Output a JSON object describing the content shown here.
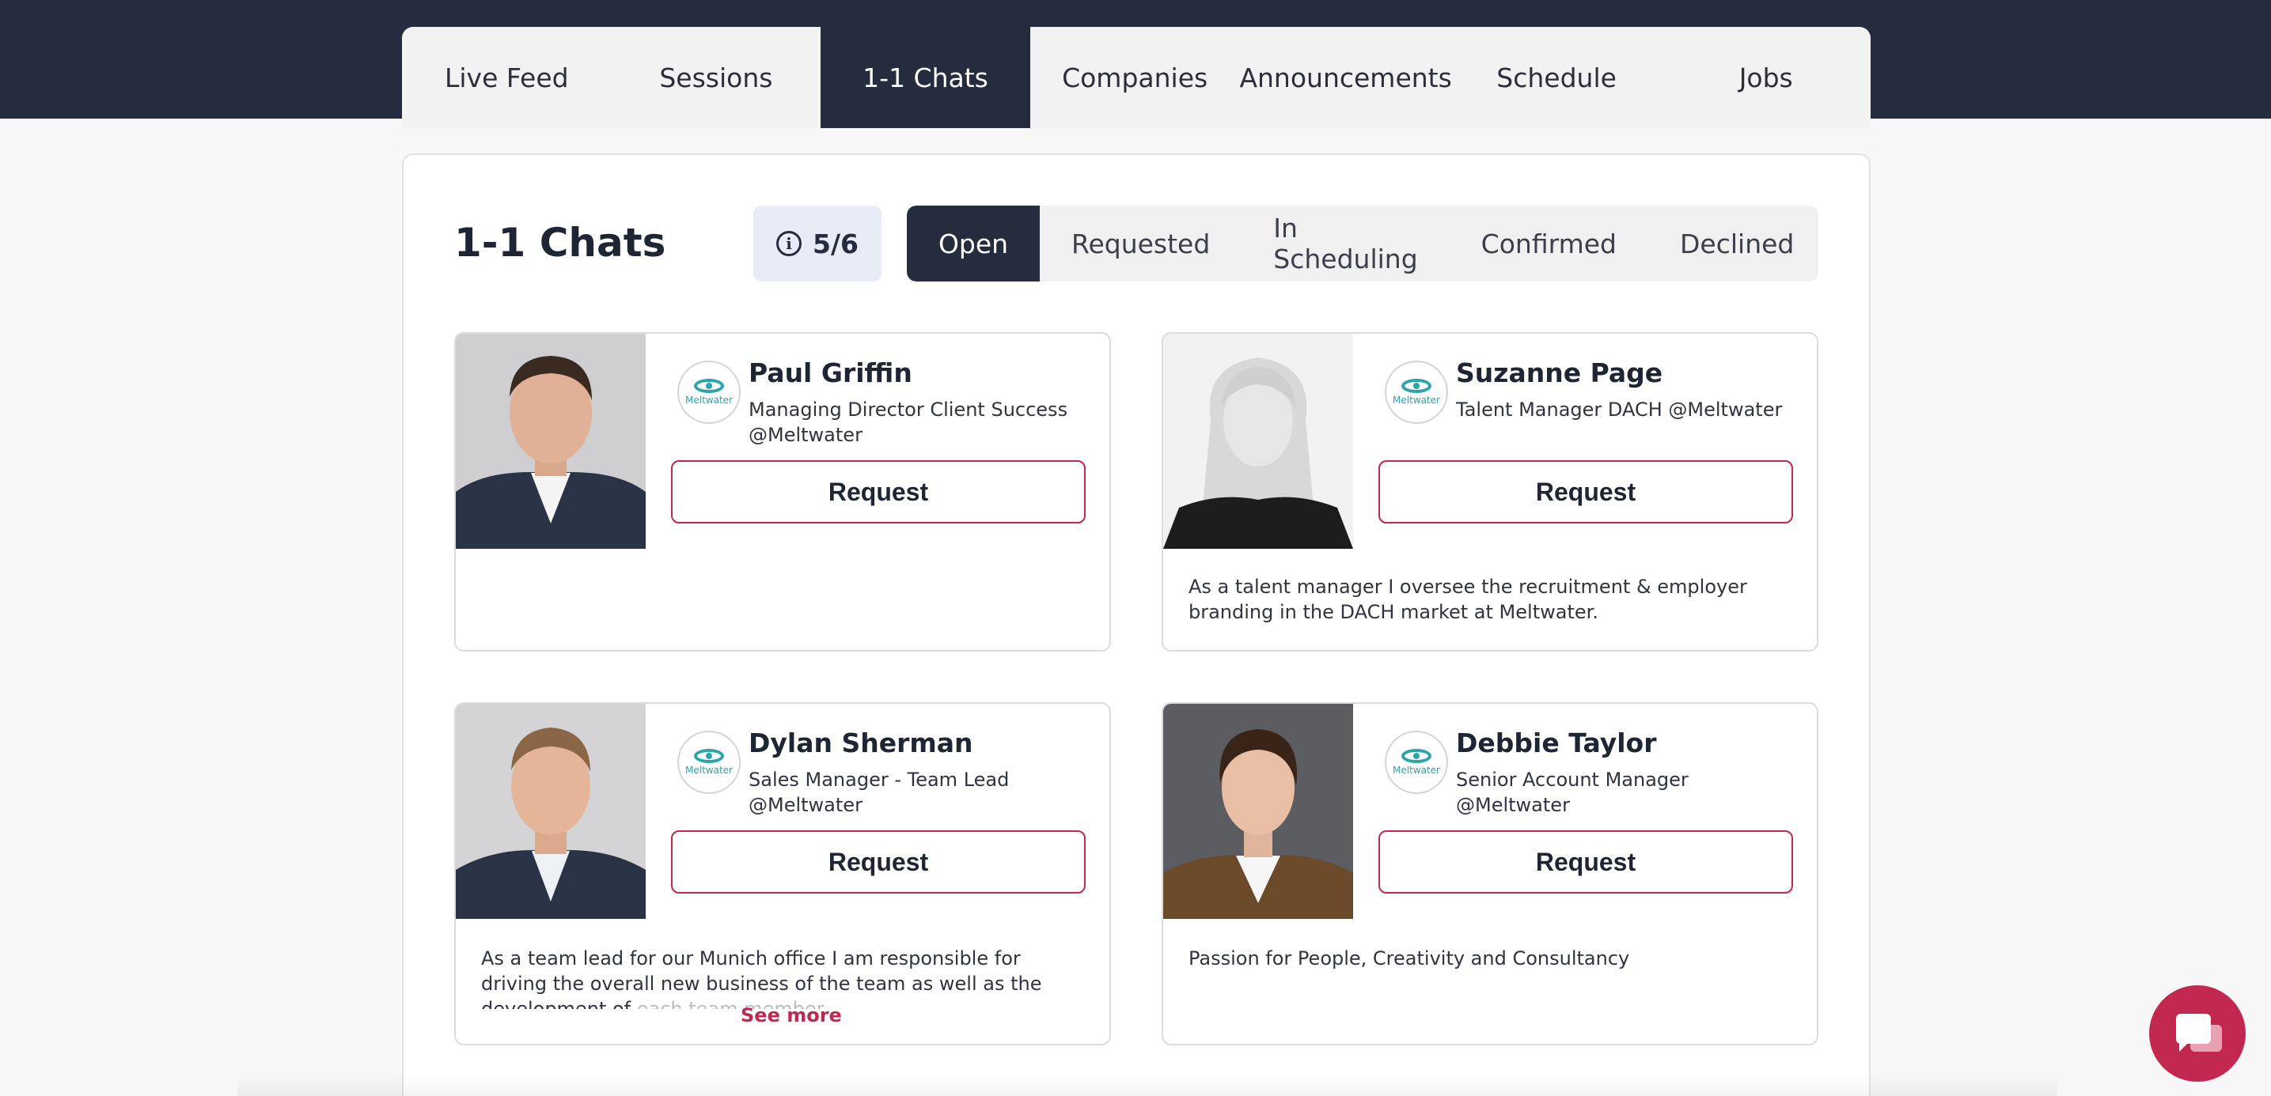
{
  "nav": {
    "tabs": [
      {
        "label": "Live Feed"
      },
      {
        "label": "Sessions"
      },
      {
        "label": "1-1 Chats"
      },
      {
        "label": "Companies"
      },
      {
        "label": "Announcements"
      },
      {
        "label": "Schedule"
      },
      {
        "label": "Jobs"
      }
    ],
    "active_tab": "1-1 Chats"
  },
  "chats": {
    "title": "1-1 Chats",
    "quota": "5/6",
    "filters": [
      {
        "label": "Open"
      },
      {
        "label": "Requested"
      },
      {
        "label": "In Scheduling"
      },
      {
        "label": "Confirmed"
      },
      {
        "label": "Declined"
      }
    ],
    "active_filter": "Open",
    "request_label": "Request",
    "see_more_label": "See more",
    "company_logo_text": "Meltwater",
    "people": [
      {
        "name": "Paul Griffin",
        "role": "Managing Director Client Success @Meltwater",
        "bio": ""
      },
      {
        "name": "Suzanne Page",
        "role": "Talent Manager DACH @Meltwater",
        "bio": "As a talent manager I oversee the recruitment & employer branding in the DACH market at Meltwater."
      },
      {
        "name": "Dylan Sherman",
        "role": "Sales Manager - Team Lead @Meltwater",
        "bio": "As a team lead for our Munich office I am responsible for driving the overall new business of the team as well as the development of",
        "bio_fade": "each team member"
      },
      {
        "name": "Debbie Taylor",
        "role": "Senior Account Manager @Meltwater",
        "bio": "Passion for People, Creativity and Consultancy"
      }
    ]
  },
  "colors": {
    "nav_dark": "#252c3d",
    "accent": "#c2274f",
    "logo_teal": "#2aa5a8"
  }
}
